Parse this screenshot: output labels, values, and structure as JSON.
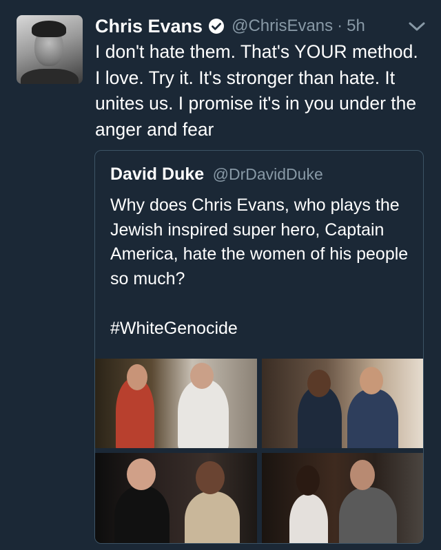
{
  "tweet": {
    "author_name": "Chris Evans",
    "author_handle": "@ChrisEvans",
    "separator": "·",
    "time": "5h",
    "text": "I don't hate them. That's YOUR method. I love. Try it. It's stronger than hate. It unites us. I promise it's in you under the anger and fear",
    "icons": {
      "verified": "verified-badge-icon",
      "more": "chevron-down-icon"
    },
    "colors": {
      "background": "#1b2836",
      "text": "#ffffff",
      "secondary_text": "#8899a6",
      "border": "#3d5466"
    }
  },
  "quoted_tweet": {
    "author_name": "David Duke",
    "author_handle": "@DrDavidDuke",
    "text": "Why does Chris Evans, who plays the Jewish inspired super hero, Captain America, hate the women of his people so much?",
    "hashtag": "#WhiteGenocide",
    "media_count": 4
  }
}
